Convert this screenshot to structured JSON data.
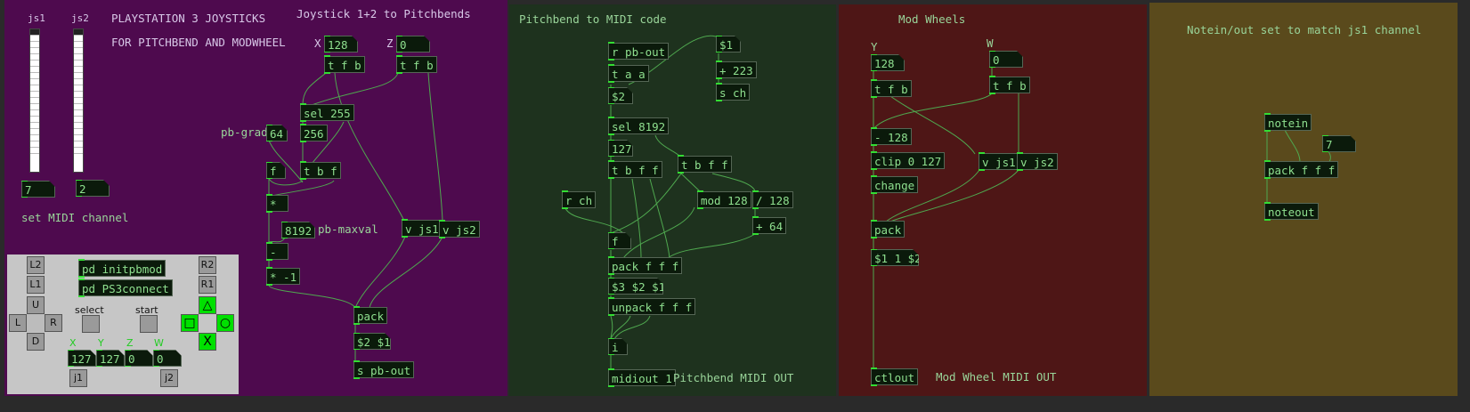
{
  "colors": {
    "panel_purple": "#4e0a4e",
    "panel_green": "#1e321e",
    "panel_red": "#4e1616",
    "panel_olive": "#5a4a1c",
    "box_bg": "#0b1a0b",
    "box_text": "#8fe08f",
    "wire": "#4fa84f"
  },
  "purple": {
    "js1": "js1",
    "js2": "js2",
    "title1": "PLAYSTATION 3 JOYSTICKS",
    "title2": "FOR PITCHBEND AND MODWHEEL",
    "subtitle": "Joystick 1+2 to Pitchbends",
    "x_label": "X",
    "z_label": "Z",
    "x_val": "128",
    "z_val": "0",
    "tfb_x": "t f b",
    "tfb_z": "t f b",
    "sel255": "sel 255",
    "n256": "256",
    "pbgrad_label": "pb-grad",
    "pbgrad_val": "64",
    "f": "f",
    "tbf": "t b f",
    "mul": "*",
    "maxval_num": "8192",
    "maxval_label": "pb-maxval",
    "minus": "-",
    "mulneg": "* -1",
    "vjs1": "v js1",
    "vjs2": "v js2",
    "pack": "pack",
    "msg21": "$2 $1",
    "spbout": "s pb-out",
    "ch1": "7",
    "ch2": "2",
    "set_midi": "set MIDI channel"
  },
  "gui": {
    "l2": "L2",
    "l1": "L1",
    "r2": "R2",
    "r1": "R1",
    "u": "U",
    "l": "L",
    "r": "R",
    "d": "D",
    "initpb": "pd initpbmod",
    "ps3connect": "pd PS3connect",
    "select": "select",
    "start": "start",
    "triangle": "△",
    "square": "□",
    "circle": "○",
    "cross": "X",
    "ax_x": "X",
    "ax_y": "Y",
    "ax_z": "Z",
    "ax_w": "W",
    "v1": "127",
    "v2": "127",
    "v3": "0",
    "v4": "0",
    "j1": "j1",
    "j2": "j2"
  },
  "green": {
    "title": "Pitchbend to MIDI code",
    "rpbout": "r pb-out",
    "taa": "t a a",
    "s2": "$2",
    "sel8192": "sel 8192",
    "n127": "127",
    "tbff": "t b f f",
    "s1": "$1",
    "plus223": "+ 223",
    "sch": "s ch",
    "tbff2": "t b f f",
    "rch": "r ch",
    "mod128": "mod 128",
    "div128": "/ 128",
    "plus64": "+ 64",
    "f": "f",
    "packfff": "pack f f f",
    "msg321": "$3 $2 $1",
    "unpack": "unpack f f f",
    "i": "i",
    "midiout": "midiout 1",
    "out_label": "Pitchbend MIDI OUT"
  },
  "red": {
    "title": "Mod Wheels",
    "y": "Y",
    "w": "W",
    "yval": "128",
    "wval": "0",
    "tfb1": "t f b",
    "tfb2": "t f b",
    "minus128": "- 128",
    "clip": "clip 0 127",
    "vjs1": "v js1",
    "vjs2": "v js2",
    "change": "change",
    "pack": "pack",
    "msg": "$1 1 $2",
    "ctlout": "ctlout",
    "out_label": "Mod Wheel MIDI OUT"
  },
  "olive": {
    "title": "Notein/out set to match js1 channel",
    "notein": "notein",
    "num": "7",
    "packfff": "pack f f f",
    "noteout": "noteout"
  }
}
